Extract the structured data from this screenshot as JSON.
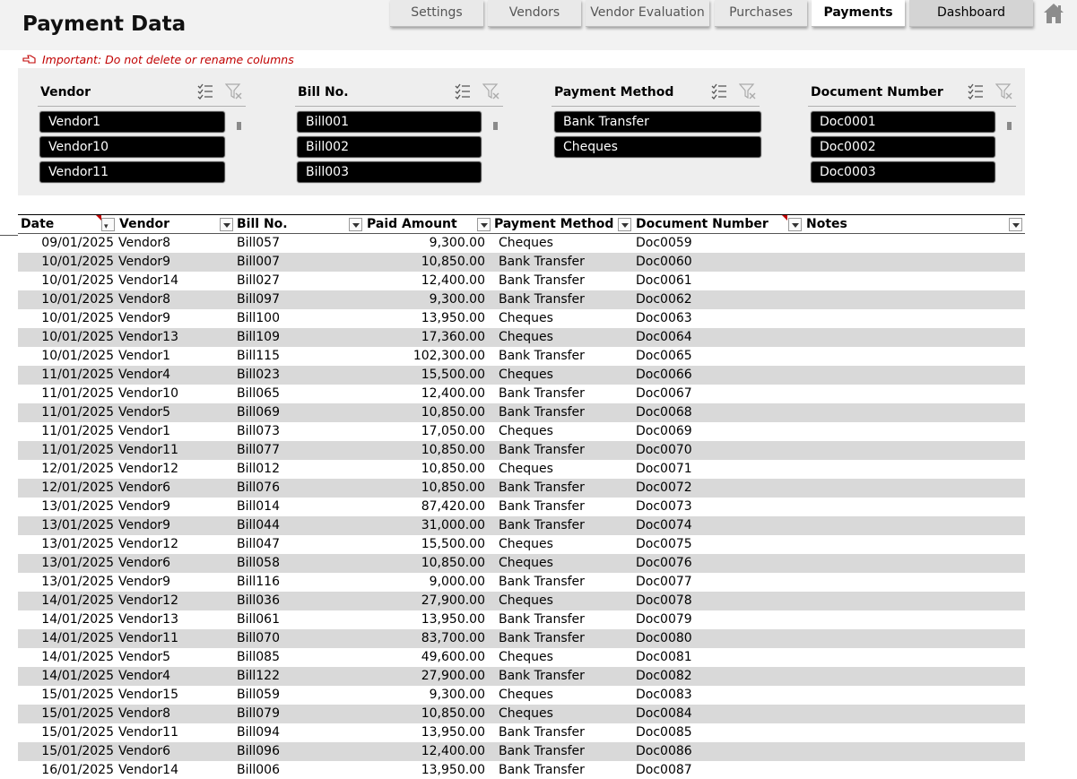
{
  "app": {
    "title": "Payment Data"
  },
  "nav": {
    "settings": "Settings",
    "vendors": "Vendors",
    "vendor_evaluation": "Vendor Evaluation",
    "purchases": "Purchases",
    "payments": "Payments",
    "dashboard": "Dashboard",
    "active": "Payments"
  },
  "warning": "Important: Do not delete or rename columns",
  "slicers": {
    "vendor": {
      "title": "Vendor",
      "items": [
        "Vendor1",
        "Vendor10",
        "Vendor11"
      ]
    },
    "bill": {
      "title": "Bill No.",
      "items": [
        "Bill001",
        "Bill002",
        "Bill003"
      ]
    },
    "method": {
      "title": "Payment Method",
      "items": [
        "Bank Transfer",
        "Cheques"
      ]
    },
    "document": {
      "title": "Document Number",
      "items": [
        "Doc0001",
        "Doc0002",
        "Doc0003"
      ]
    }
  },
  "table": {
    "columns": [
      "Date",
      "Vendor",
      "Bill No.",
      "Paid Amount",
      "Payment Method",
      "Document Number",
      "Notes"
    ],
    "rows": [
      [
        "09/01/2025",
        "Vendor8",
        "Bill057",
        "9,300.00",
        "Cheques",
        "Doc0059"
      ],
      [
        "10/01/2025",
        "Vendor9",
        "Bill007",
        "10,850.00",
        "Bank Transfer",
        "Doc0060"
      ],
      [
        "10/01/2025",
        "Vendor14",
        "Bill027",
        "12,400.00",
        "Bank Transfer",
        "Doc0061"
      ],
      [
        "10/01/2025",
        "Vendor8",
        "Bill097",
        "9,300.00",
        "Bank Transfer",
        "Doc0062"
      ],
      [
        "10/01/2025",
        "Vendor9",
        "Bill100",
        "13,950.00",
        "Cheques",
        "Doc0063"
      ],
      [
        "10/01/2025",
        "Vendor13",
        "Bill109",
        "17,360.00",
        "Cheques",
        "Doc0064"
      ],
      [
        "10/01/2025",
        "Vendor1",
        "Bill115",
        "102,300.00",
        "Bank Transfer",
        "Doc0065"
      ],
      [
        "11/01/2025",
        "Vendor4",
        "Bill023",
        "15,500.00",
        "Cheques",
        "Doc0066"
      ],
      [
        "11/01/2025",
        "Vendor10",
        "Bill065",
        "12,400.00",
        "Bank Transfer",
        "Doc0067"
      ],
      [
        "11/01/2025",
        "Vendor5",
        "Bill069",
        "10,850.00",
        "Bank Transfer",
        "Doc0068"
      ],
      [
        "11/01/2025",
        "Vendor1",
        "Bill073",
        "17,050.00",
        "Cheques",
        "Doc0069"
      ],
      [
        "11/01/2025",
        "Vendor11",
        "Bill077",
        "10,850.00",
        "Bank Transfer",
        "Doc0070"
      ],
      [
        "12/01/2025",
        "Vendor12",
        "Bill012",
        "10,850.00",
        "Cheques",
        "Doc0071"
      ],
      [
        "12/01/2025",
        "Vendor6",
        "Bill076",
        "10,850.00",
        "Bank Transfer",
        "Doc0072"
      ],
      [
        "13/01/2025",
        "Vendor9",
        "Bill014",
        "87,420.00",
        "Bank Transfer",
        "Doc0073"
      ],
      [
        "13/01/2025",
        "Vendor9",
        "Bill044",
        "31,000.00",
        "Bank Transfer",
        "Doc0074"
      ],
      [
        "13/01/2025",
        "Vendor12",
        "Bill047",
        "15,500.00",
        "Cheques",
        "Doc0075"
      ],
      [
        "13/01/2025",
        "Vendor6",
        "Bill058",
        "10,850.00",
        "Cheques",
        "Doc0076"
      ],
      [
        "13/01/2025",
        "Vendor9",
        "Bill116",
        "9,000.00",
        "Bank Transfer",
        "Doc0077"
      ],
      [
        "14/01/2025",
        "Vendor12",
        "Bill036",
        "27,900.00",
        "Cheques",
        "Doc0078"
      ],
      [
        "14/01/2025",
        "Vendor13",
        "Bill061",
        "13,950.00",
        "Bank Transfer",
        "Doc0079"
      ],
      [
        "14/01/2025",
        "Vendor11",
        "Bill070",
        "83,700.00",
        "Bank Transfer",
        "Doc0080"
      ],
      [
        "14/01/2025",
        "Vendor5",
        "Bill085",
        "49,600.00",
        "Cheques",
        "Doc0081"
      ],
      [
        "14/01/2025",
        "Vendor4",
        "Bill122",
        "27,900.00",
        "Bank Transfer",
        "Doc0082"
      ],
      [
        "15/01/2025",
        "Vendor15",
        "Bill059",
        "9,300.00",
        "Cheques",
        "Doc0083"
      ],
      [
        "15/01/2025",
        "Vendor8",
        "Bill079",
        "10,850.00",
        "Cheques",
        "Doc0084"
      ],
      [
        "15/01/2025",
        "Vendor11",
        "Bill094",
        "13,950.00",
        "Bank Transfer",
        "Doc0085"
      ],
      [
        "15/01/2025",
        "Vendor6",
        "Bill096",
        "12,400.00",
        "Bank Transfer",
        "Doc0086"
      ],
      [
        "16/01/2025",
        "Vendor14",
        "Bill006",
        "13,950.00",
        "Bank Transfer",
        "Doc0087"
      ]
    ]
  },
  "colors": {
    "accent_red": "#c00000",
    "row_alt": "#d9d9d9",
    "slicer_bg": "#eeeeee"
  },
  "icons": {
    "home": "home-icon",
    "multi_select": "multi-select-icon",
    "clear_filter": "clear-filter-icon",
    "hand": "pointing-hand-icon"
  }
}
